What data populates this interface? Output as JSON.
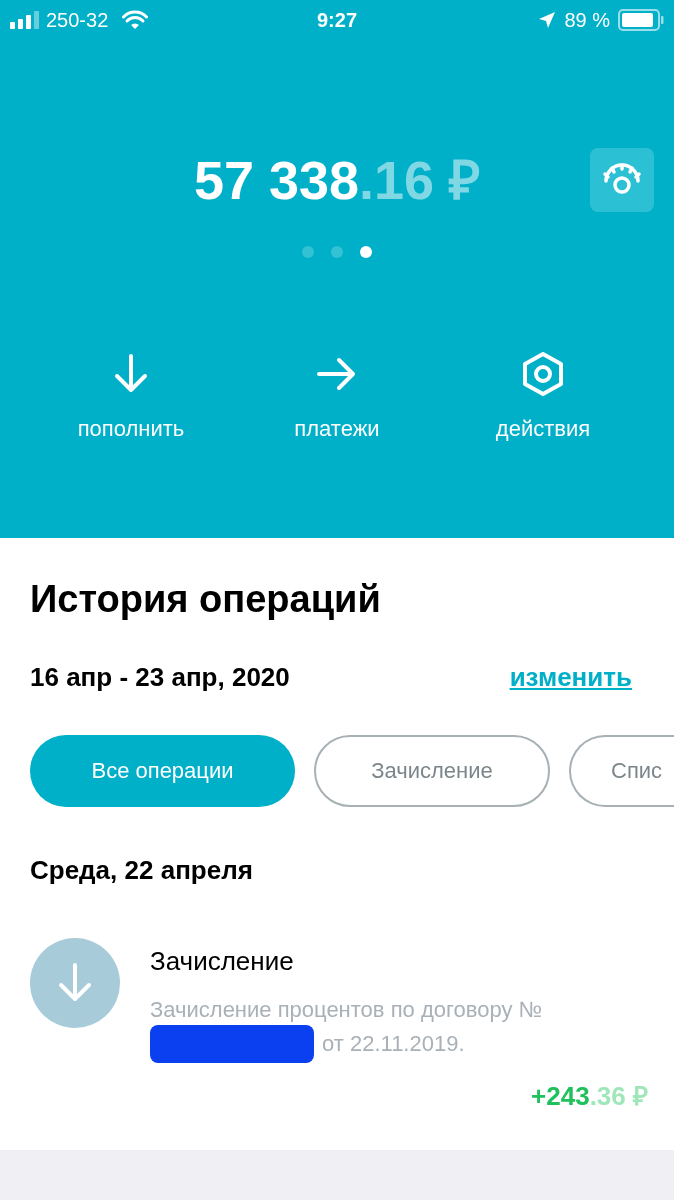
{
  "status_bar": {
    "carrier": "250-32",
    "time": "9:27",
    "battery": "89 %"
  },
  "balance": {
    "whole": "57 338",
    "fraction": ".16 ₽"
  },
  "pager": [
    {
      "selected": false
    },
    {
      "selected": false
    },
    {
      "selected": true
    }
  ],
  "actions": [
    {
      "kind": "down",
      "label": "пополнить"
    },
    {
      "kind": "right",
      "label": "платежи"
    },
    {
      "kind": "hexagon",
      "label": "действия"
    }
  ],
  "history": {
    "title": "История операций",
    "period": "16 апр - 23 апр, 2020",
    "change_link": "изменить"
  },
  "filters": [
    {
      "label": "Все операции",
      "selected": true
    },
    {
      "label": "Зачисление",
      "selected": false
    },
    {
      "label": "Спис",
      "selected": false
    }
  ],
  "days": [
    {
      "title": "Среда, 22 апреля",
      "operations": [
        {
          "title": "Зачисление",
          "description_start": "Зачисление процентов по договору №",
          "description_end": "от 22.11.2019.",
          "amount_whole": "+243",
          "amount_fraction": ".36 ₽"
        }
      ]
    }
  ]
}
